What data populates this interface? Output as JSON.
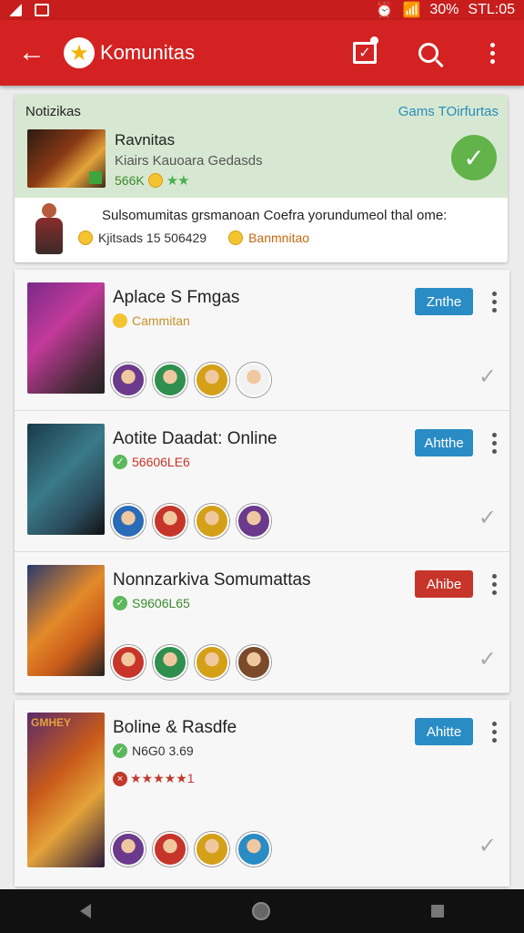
{
  "status_bar": {
    "battery_text": "30%",
    "time": "STL:05"
  },
  "app_bar": {
    "title": "Komunitas"
  },
  "notification": {
    "header": "Notizikas",
    "link": "Gams TOirfurtas",
    "name": "Ravnitas",
    "subtitle": "Kiairs Kauoara Gedasds",
    "count": "566K",
    "message": "Sulsomumitas grsmanoan Coefra yorundumeol thal ome:",
    "stats_left": "Kjitsads 15 506429",
    "stats_right": "Banmnitao"
  },
  "games": [
    {
      "title": "Aplace S Fmgas",
      "status": "Cammitan",
      "status_color": "yellow",
      "button": "Znthe",
      "button_color": "#2a8cc4",
      "avatars": [
        "#6b3a8c",
        "#2f8f4e",
        "#d4a017",
        "#f2f2f2"
      ],
      "art": "linear-gradient(135deg,#7a2a8a 0%,#c23a9a 40%,#4a2a3a 80%,#222 100%)"
    },
    {
      "title": "Aotite Daadat: Online",
      "status": "56606LE6",
      "status_color": "green",
      "button": "Ahtthe",
      "button_color": "#2a8cc4",
      "avatars": [
        "#2a6bb8",
        "#c7352a",
        "#d4a017",
        "#6b3a8c"
      ],
      "art": "linear-gradient(135deg,#1a3a4a 0%,#3a7a8a 45%,#2a4a5a 75%,#111 100%)"
    },
    {
      "title": "Nonnzarkiva Somumattas",
      "status": "S9606L65",
      "status_color": "green",
      "button": "Ahibe",
      "button_color": "#c7352a",
      "avatars": [
        "#c7352a",
        "#2f8f4e",
        "#d4a017",
        "#7a4a2a"
      ],
      "art": "linear-gradient(135deg,#2a3a6a 0%,#e48a2a 45%,#c85a1a 70%,#222 100%)"
    },
    {
      "title": "Boline & Rasdfe",
      "status": "N6G0 3.69",
      "status_color": "green",
      "rating": "★★★★★1",
      "button": "Ahitte",
      "button_color": "#2a8cc4",
      "avatars": [
        "#6b3a8c",
        "#c7352a",
        "#d4a017",
        "#2a8cc4"
      ],
      "art": "linear-gradient(135deg,#5a2a6a 0%,#c85a1a 40%,#e4a33a 65%,#2a1a3a 100%)",
      "banner": "GMHEY"
    }
  ]
}
